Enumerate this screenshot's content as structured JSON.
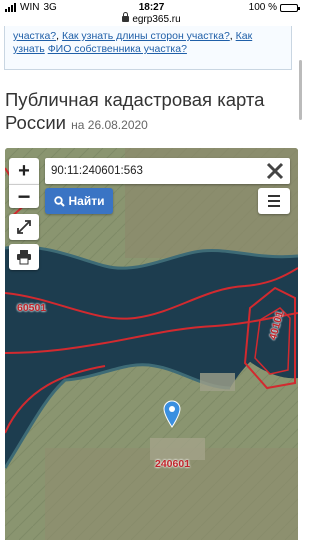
{
  "status_bar": {
    "carrier": "WIN",
    "network": "3G",
    "time": "18:27",
    "battery": "100 %"
  },
  "browser": {
    "url": "egrp365.ru"
  },
  "info_box": {
    "link1": "участка?",
    "link2": "Как узнать длины сторон участка?",
    "link3": "Как узнать",
    "link4": "ФИО собственника участка?"
  },
  "page": {
    "title": "Публичная кадастровая карта России",
    "date_prefix": "на",
    "date": "26.08.2020"
  },
  "map": {
    "search_value": "90:11:240601:563",
    "find_button_label": "Найти",
    "zoom_in_label": "+",
    "zoom_out_label": "−",
    "parcel_labels": [
      "60501",
      "240601",
      "40101"
    ],
    "border_color": "#d22a2f",
    "accent_color": "#3a74c4"
  }
}
